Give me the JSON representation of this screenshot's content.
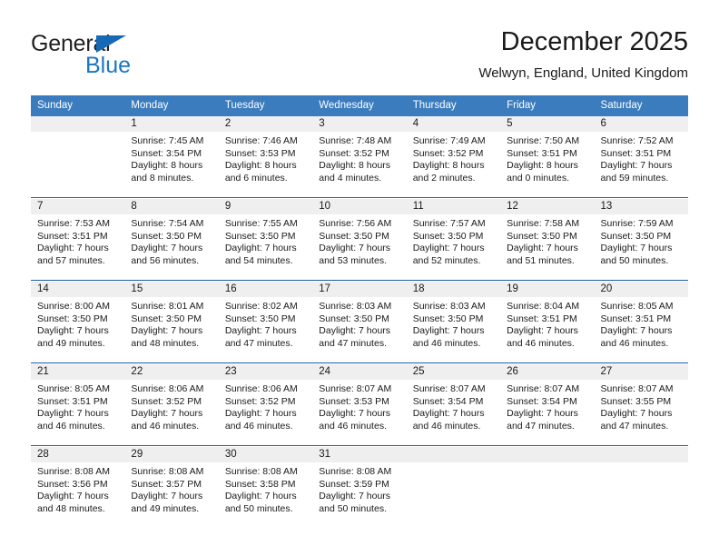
{
  "brand": {
    "word1": "General",
    "word2": "Blue",
    "triangle_color": "#1669b4",
    "blue_color": "#1a76c4"
  },
  "header": {
    "title": "December 2025",
    "subtitle": "Welwyn, England, United Kingdom"
  },
  "theme": {
    "header_blue": "#3a7cbe",
    "separator_blue": "#1f5fa0",
    "daynum_band": "#efefef"
  },
  "weekday_headers": [
    "Sunday",
    "Monday",
    "Tuesday",
    "Wednesday",
    "Thursday",
    "Friday",
    "Saturday"
  ],
  "weeks": [
    {
      "days": [
        {
          "day": "",
          "sunrise": "",
          "sunset": "",
          "daylight1": "",
          "daylight2": ""
        },
        {
          "day": "1",
          "sunrise": "Sunrise: 7:45 AM",
          "sunset": "Sunset: 3:54 PM",
          "daylight1": "Daylight: 8 hours",
          "daylight2": "and 8 minutes."
        },
        {
          "day": "2",
          "sunrise": "Sunrise: 7:46 AM",
          "sunset": "Sunset: 3:53 PM",
          "daylight1": "Daylight: 8 hours",
          "daylight2": "and 6 minutes."
        },
        {
          "day": "3",
          "sunrise": "Sunrise: 7:48 AM",
          "sunset": "Sunset: 3:52 PM",
          "daylight1": "Daylight: 8 hours",
          "daylight2": "and 4 minutes."
        },
        {
          "day": "4",
          "sunrise": "Sunrise: 7:49 AM",
          "sunset": "Sunset: 3:52 PM",
          "daylight1": "Daylight: 8 hours",
          "daylight2": "and 2 minutes."
        },
        {
          "day": "5",
          "sunrise": "Sunrise: 7:50 AM",
          "sunset": "Sunset: 3:51 PM",
          "daylight1": "Daylight: 8 hours",
          "daylight2": "and 0 minutes."
        },
        {
          "day": "6",
          "sunrise": "Sunrise: 7:52 AM",
          "sunset": "Sunset: 3:51 PM",
          "daylight1": "Daylight: 7 hours",
          "daylight2": "and 59 minutes."
        }
      ]
    },
    {
      "days": [
        {
          "day": "7",
          "sunrise": "Sunrise: 7:53 AM",
          "sunset": "Sunset: 3:51 PM",
          "daylight1": "Daylight: 7 hours",
          "daylight2": "and 57 minutes."
        },
        {
          "day": "8",
          "sunrise": "Sunrise: 7:54 AM",
          "sunset": "Sunset: 3:50 PM",
          "daylight1": "Daylight: 7 hours",
          "daylight2": "and 56 minutes."
        },
        {
          "day": "9",
          "sunrise": "Sunrise: 7:55 AM",
          "sunset": "Sunset: 3:50 PM",
          "daylight1": "Daylight: 7 hours",
          "daylight2": "and 54 minutes."
        },
        {
          "day": "10",
          "sunrise": "Sunrise: 7:56 AM",
          "sunset": "Sunset: 3:50 PM",
          "daylight1": "Daylight: 7 hours",
          "daylight2": "and 53 minutes."
        },
        {
          "day": "11",
          "sunrise": "Sunrise: 7:57 AM",
          "sunset": "Sunset: 3:50 PM",
          "daylight1": "Daylight: 7 hours",
          "daylight2": "and 52 minutes."
        },
        {
          "day": "12",
          "sunrise": "Sunrise: 7:58 AM",
          "sunset": "Sunset: 3:50 PM",
          "daylight1": "Daylight: 7 hours",
          "daylight2": "and 51 minutes."
        },
        {
          "day": "13",
          "sunrise": "Sunrise: 7:59 AM",
          "sunset": "Sunset: 3:50 PM",
          "daylight1": "Daylight: 7 hours",
          "daylight2": "and 50 minutes."
        }
      ]
    },
    {
      "days": [
        {
          "day": "14",
          "sunrise": "Sunrise: 8:00 AM",
          "sunset": "Sunset: 3:50 PM",
          "daylight1": "Daylight: 7 hours",
          "daylight2": "and 49 minutes."
        },
        {
          "day": "15",
          "sunrise": "Sunrise: 8:01 AM",
          "sunset": "Sunset: 3:50 PM",
          "daylight1": "Daylight: 7 hours",
          "daylight2": "and 48 minutes."
        },
        {
          "day": "16",
          "sunrise": "Sunrise: 8:02 AM",
          "sunset": "Sunset: 3:50 PM",
          "daylight1": "Daylight: 7 hours",
          "daylight2": "and 47 minutes."
        },
        {
          "day": "17",
          "sunrise": "Sunrise: 8:03 AM",
          "sunset": "Sunset: 3:50 PM",
          "daylight1": "Daylight: 7 hours",
          "daylight2": "and 47 minutes."
        },
        {
          "day": "18",
          "sunrise": "Sunrise: 8:03 AM",
          "sunset": "Sunset: 3:50 PM",
          "daylight1": "Daylight: 7 hours",
          "daylight2": "and 46 minutes."
        },
        {
          "day": "19",
          "sunrise": "Sunrise: 8:04 AM",
          "sunset": "Sunset: 3:51 PM",
          "daylight1": "Daylight: 7 hours",
          "daylight2": "and 46 minutes."
        },
        {
          "day": "20",
          "sunrise": "Sunrise: 8:05 AM",
          "sunset": "Sunset: 3:51 PM",
          "daylight1": "Daylight: 7 hours",
          "daylight2": "and 46 minutes."
        }
      ]
    },
    {
      "days": [
        {
          "day": "21",
          "sunrise": "Sunrise: 8:05 AM",
          "sunset": "Sunset: 3:51 PM",
          "daylight1": "Daylight: 7 hours",
          "daylight2": "and 46 minutes."
        },
        {
          "day": "22",
          "sunrise": "Sunrise: 8:06 AM",
          "sunset": "Sunset: 3:52 PM",
          "daylight1": "Daylight: 7 hours",
          "daylight2": "and 46 minutes."
        },
        {
          "day": "23",
          "sunrise": "Sunrise: 8:06 AM",
          "sunset": "Sunset: 3:52 PM",
          "daylight1": "Daylight: 7 hours",
          "daylight2": "and 46 minutes."
        },
        {
          "day": "24",
          "sunrise": "Sunrise: 8:07 AM",
          "sunset": "Sunset: 3:53 PM",
          "daylight1": "Daylight: 7 hours",
          "daylight2": "and 46 minutes."
        },
        {
          "day": "25",
          "sunrise": "Sunrise: 8:07 AM",
          "sunset": "Sunset: 3:54 PM",
          "daylight1": "Daylight: 7 hours",
          "daylight2": "and 46 minutes."
        },
        {
          "day": "26",
          "sunrise": "Sunrise: 8:07 AM",
          "sunset": "Sunset: 3:54 PM",
          "daylight1": "Daylight: 7 hours",
          "daylight2": "and 47 minutes."
        },
        {
          "day": "27",
          "sunrise": "Sunrise: 8:07 AM",
          "sunset": "Sunset: 3:55 PM",
          "daylight1": "Daylight: 7 hours",
          "daylight2": "and 47 minutes."
        }
      ]
    },
    {
      "days": [
        {
          "day": "28",
          "sunrise": "Sunrise: 8:08 AM",
          "sunset": "Sunset: 3:56 PM",
          "daylight1": "Daylight: 7 hours",
          "daylight2": "and 48 minutes."
        },
        {
          "day": "29",
          "sunrise": "Sunrise: 8:08 AM",
          "sunset": "Sunset: 3:57 PM",
          "daylight1": "Daylight: 7 hours",
          "daylight2": "and 49 minutes."
        },
        {
          "day": "30",
          "sunrise": "Sunrise: 8:08 AM",
          "sunset": "Sunset: 3:58 PM",
          "daylight1": "Daylight: 7 hours",
          "daylight2": "and 50 minutes."
        },
        {
          "day": "31",
          "sunrise": "Sunrise: 8:08 AM",
          "sunset": "Sunset: 3:59 PM",
          "daylight1": "Daylight: 7 hours",
          "daylight2": "and 50 minutes."
        },
        {
          "day": "",
          "sunrise": "",
          "sunset": "",
          "daylight1": "",
          "daylight2": ""
        },
        {
          "day": "",
          "sunrise": "",
          "sunset": "",
          "daylight1": "",
          "daylight2": ""
        },
        {
          "day": "",
          "sunrise": "",
          "sunset": "",
          "daylight1": "",
          "daylight2": ""
        }
      ]
    }
  ]
}
